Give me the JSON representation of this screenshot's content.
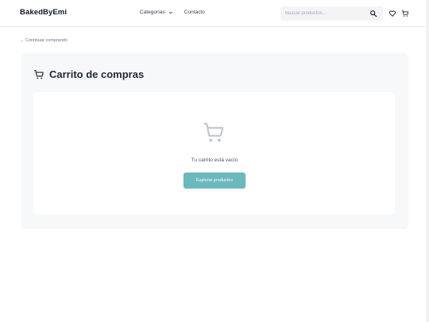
{
  "header": {
    "brand": "BakedByEmi",
    "nav": [
      {
        "label": "Categorías",
        "has_dropdown": true
      },
      {
        "label": "Contacto",
        "has_dropdown": false
      }
    ],
    "search": {
      "placeholder": "Buscar productos...",
      "value": "",
      "icon": "search-icon"
    },
    "icons": [
      "heart-icon",
      "cart-icon"
    ]
  },
  "back_link": "← Continuar comprando",
  "cart": {
    "title": "Carrito de compras",
    "title_icon": "cart-icon",
    "empty_icon": "cart-icon",
    "empty_message": "Tu carrito está vacío",
    "cta_label": "Explorar productos"
  },
  "colors": {
    "accent": "#6bb8bd",
    "panel_bg": "#f7f8fa",
    "empty_icon": "#c4c8d0"
  }
}
